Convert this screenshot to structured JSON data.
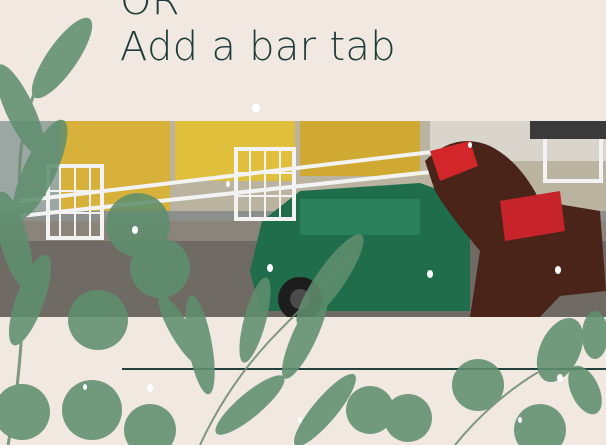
{
  "heading": {
    "line1": "OR",
    "line2": "Add a bar tab"
  },
  "photo": {
    "alt_subject": "harness-racing-photo"
  },
  "decor": {
    "leaf_color": "#5f8f6e",
    "text_color": "#1d3c3a",
    "background_color": "#f1e8e1"
  }
}
